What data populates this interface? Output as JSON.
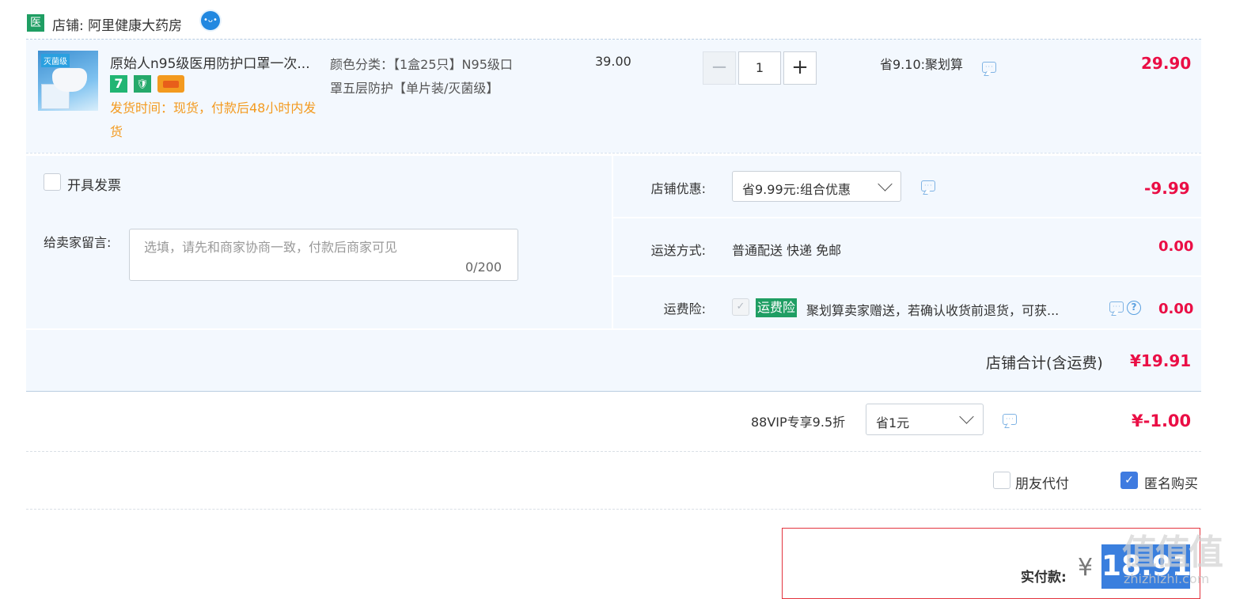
{
  "shop": {
    "badge": "医",
    "label": "店铺: 阿里健康大药房",
    "ww_icon": "wangwang-chat-icon"
  },
  "item": {
    "title": "原始人n95级医用防护口罩一次...",
    "thumb_tag": "灭菌级",
    "badge_seven": "7",
    "ship_time": "发货时间：现货，付款后48小时内发货",
    "sku_line1": "颜色分类：【1盒25只】N95级口",
    "sku_line2": "罩五层防护【单片装/灭菌级】",
    "unit_price": "39.00",
    "qty": "1",
    "qty_minus": "−",
    "qty_plus": "+",
    "promo": "省9.10:聚划算",
    "price": "29.90"
  },
  "options": {
    "invoice_label": "开具发票",
    "memo_label": "给卖家留言:",
    "memo_placeholder": "选填，请先和商家协商一致，付款后商家可见",
    "memo_count": "0/200",
    "shop_coupon_label": "店铺优惠:",
    "shop_coupon_value": "省9.99元:组合优惠",
    "shop_coupon_amount": "-9.99",
    "ship_label": "运送方式:",
    "ship_value": "普通配送 快递 免邮",
    "ship_amount": "0.00",
    "ins_label": "运费险:",
    "ins_tag": "运费险",
    "ins_text": "聚划算卖家赠送，若确认收货前退货，可获...",
    "ins_amount": "0.00"
  },
  "total": {
    "label": "店铺合计(含运费)",
    "value": "¥19.91"
  },
  "vip": {
    "label": "88VIP专享9.5折",
    "select": "省1元",
    "value": "¥-1.00"
  },
  "extras": {
    "friend_pay": "朋友代付",
    "anonymous": "匿名购买"
  },
  "pay": {
    "label": "实付款:",
    "yen": "¥",
    "amount": "18.91"
  },
  "watermark": {
    "main": "值值值",
    "sub": "zhizhizhi.com"
  },
  "colors": {
    "accent_red": "#ea0e45",
    "brand_green": "#1f9e63",
    "panel_bg": "#f3f8fe",
    "pay_blue": "#3a7fde"
  }
}
